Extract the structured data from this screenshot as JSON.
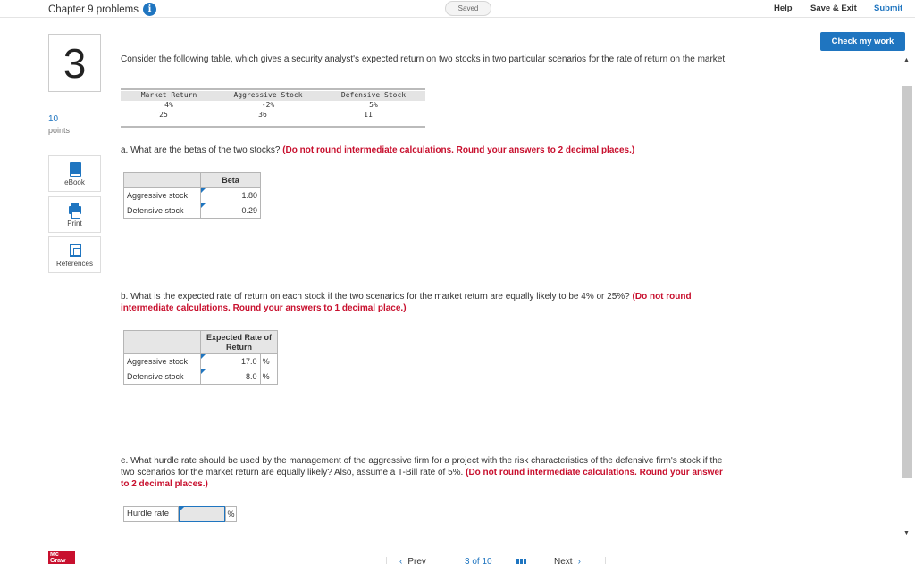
{
  "header": {
    "chapter_title": "Chapter 9 problems",
    "info_icon": "i",
    "saved_label": "Saved",
    "help_label": "Help",
    "save_exit_label": "Save & Exit",
    "submit_label": "Submit",
    "check_label": "Check my work"
  },
  "question": {
    "number": "3",
    "points_value": "10",
    "points_label": "points",
    "intro": "Consider the following table, which gives a security analyst's expected return on two stocks in two particular scenarios for the rate of return on the market:"
  },
  "sidebar": {
    "ebook_label": "eBook",
    "print_label": "Print",
    "references_label": "References"
  },
  "data_table": {
    "headers": [
      "Market Return",
      "Aggressive Stock",
      "Defensive Stock"
    ],
    "rows": [
      [
        "4%",
        "-2%",
        "5%"
      ],
      [
        "25",
        "36",
        "11"
      ]
    ]
  },
  "part_a": {
    "question": "a. What are the betas of the two stocks?",
    "instruction": "(Do not round intermediate calculations. Round your answers to 2 decimal places.)",
    "column_header": "Beta",
    "rows": [
      {
        "label": "Aggressive stock",
        "value": "1.80"
      },
      {
        "label": "Defensive stock",
        "value": "0.29"
      }
    ]
  },
  "part_b": {
    "question": "b. What is the expected rate of return on each stock if the two scenarios for the market return are equally likely to be 4% or 25%?",
    "instruction": "(Do not round intermediate calculations. Round your answers to 1 decimal place.)",
    "column_header_line1": "Expected Rate of",
    "column_header_line2": "Return",
    "unit": "%",
    "rows": [
      {
        "label": "Aggressive stock",
        "value": "17.0"
      },
      {
        "label": "Defensive stock",
        "value": "8.0"
      }
    ]
  },
  "part_e": {
    "question": "e. What hurdle rate should be used by the management of the aggressive firm for a project with the risk characteristics of the defensive firm's stock if the two scenarios for the market return are equally likely? Also, assume a T-Bill rate of 5%.",
    "instruction": "(Do not round intermediate calculations. Round your answer to 2 decimal places.)",
    "input_label": "Hurdle rate",
    "input_value": "",
    "unit": "%"
  },
  "footer": {
    "logo_text": "Mc Graw",
    "prev_label": "Prev",
    "page_indicator": "3 of 10",
    "next_label": "Next"
  }
}
